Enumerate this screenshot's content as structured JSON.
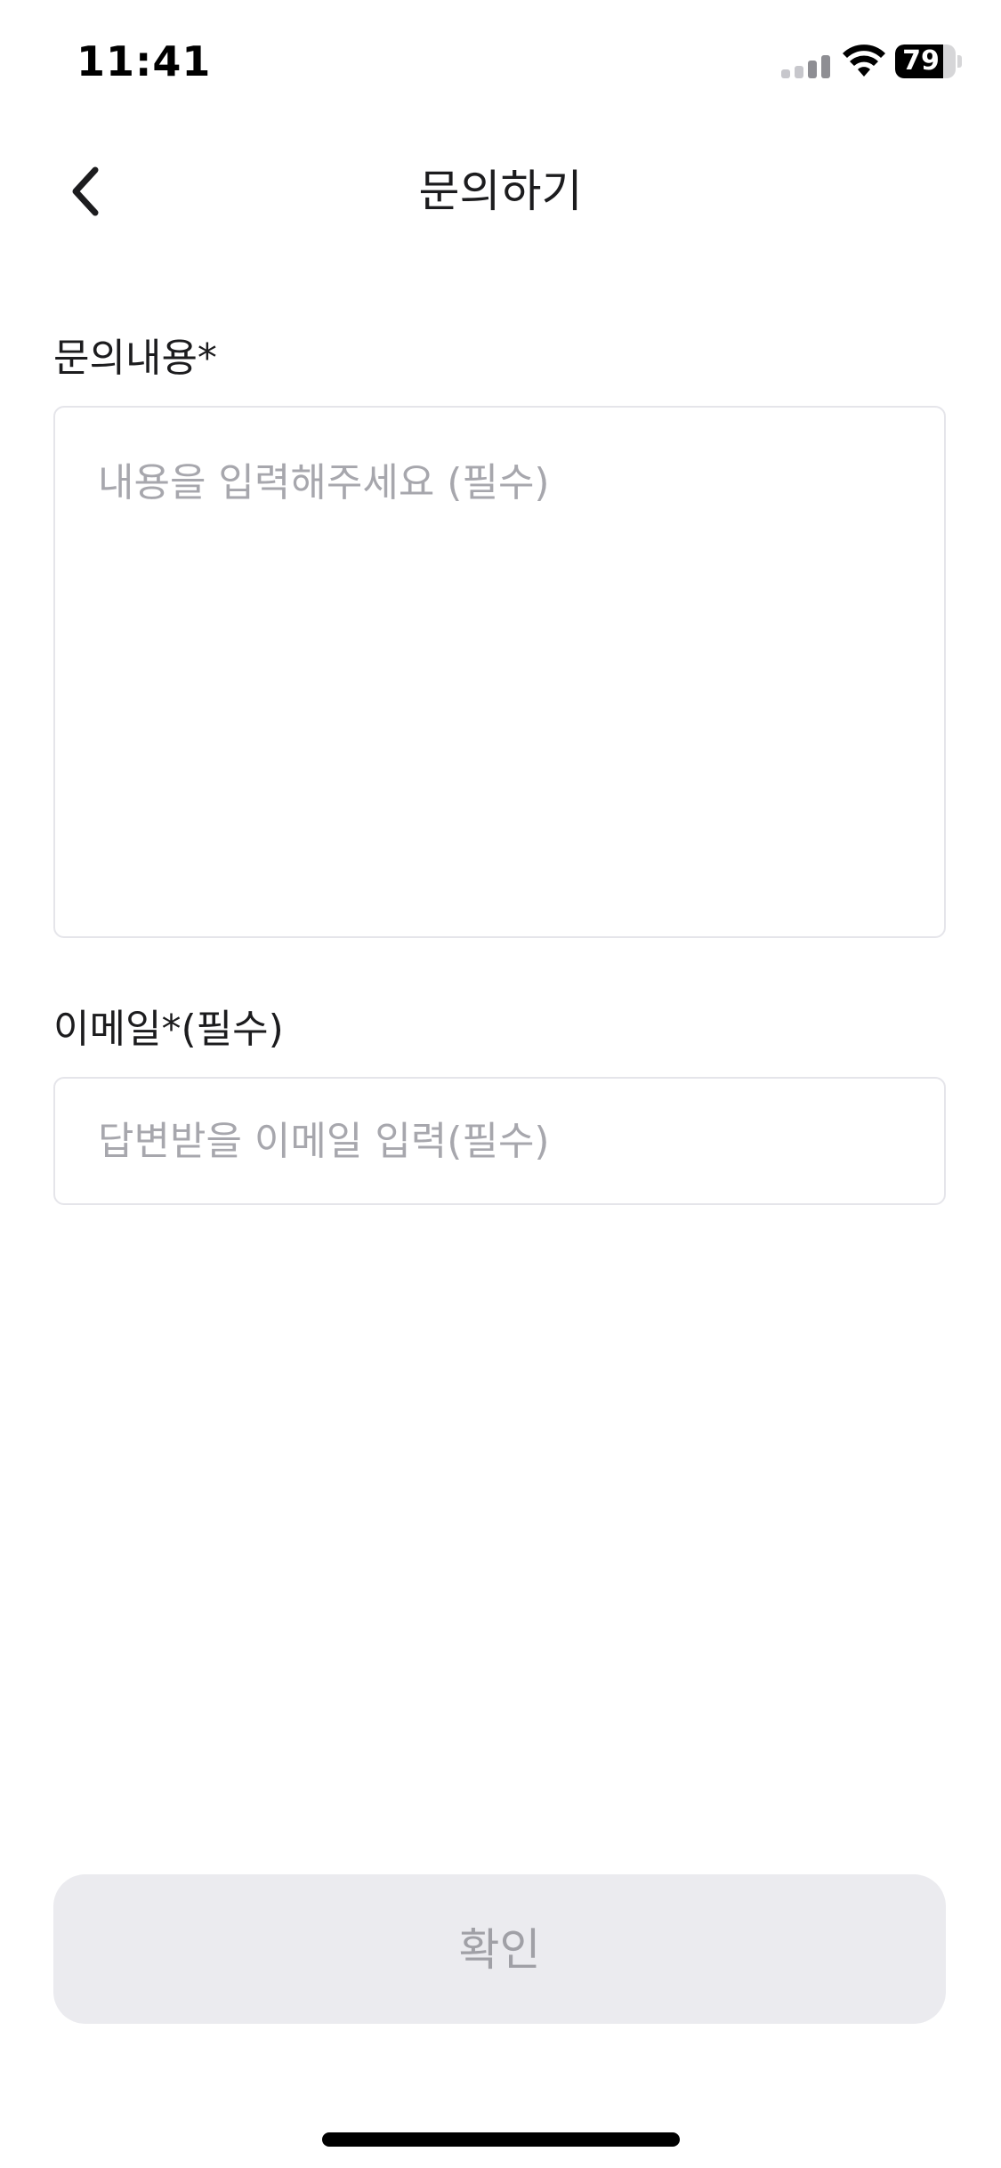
{
  "status_bar": {
    "time": "11:41",
    "battery_level": "79",
    "battery_fraction": 0.79,
    "signal_icon": "cellular-signal-icon",
    "wifi_icon": "wifi-icon"
  },
  "nav": {
    "title": "문의하기",
    "back_icon": "chevron-left-icon"
  },
  "form": {
    "content_label": "문의내용*",
    "content_placeholder": "내용을 입력해주세요 (필수)",
    "content_value": "",
    "email_label": "이메일*(필수)",
    "email_placeholder": "답변받을 이메일 입력(필수)",
    "email_value": ""
  },
  "confirm_button": {
    "label": "확인",
    "disabled": true
  },
  "colors": {
    "background": "#ffffff",
    "text": "#1c1c1e",
    "placeholder": "#a7a7ad",
    "border": "#e5e5ea",
    "button_bg_disabled": "#ebebef",
    "button_text_disabled": "#a0a0a6"
  }
}
